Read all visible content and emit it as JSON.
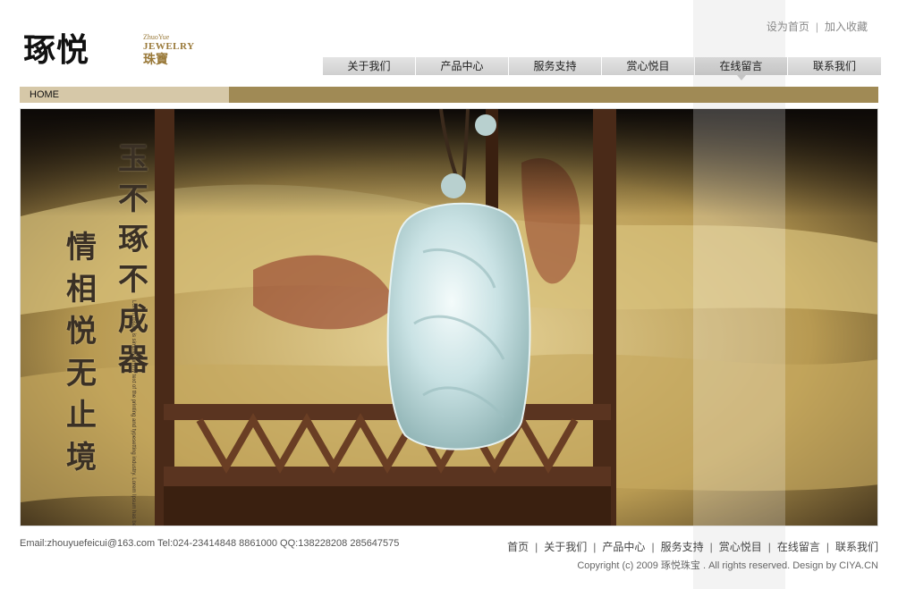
{
  "logo": {
    "main": "琢悦",
    "en_small": "ZhuoYue",
    "en": "JEWELRY",
    "cn": "珠寶"
  },
  "top_links": [
    "设为首页",
    "加入收藏"
  ],
  "nav": {
    "items": [
      "关于我们",
      "产品中心",
      "服务支持",
      "赏心悦目",
      "在线留言",
      "联系我们"
    ],
    "active": "在线留言"
  },
  "breadcrumb": {
    "home": "HOME"
  },
  "banner": {
    "text_a": "玉不琢不成器",
    "text_b": "情相悦无止境",
    "small_text": "Lorem Ipsum is simply dummy text of the printing and typesetting industry. Lorem Ipsum has been the industry's standard dummy text ever since the 1500s, when an unknown printer took a galley of type and scrambled it to make a type specimen book. It has survived not only five centuries, but also the leap into electronic typesetting, remaining essentially unchanged."
  },
  "footer": {
    "contact": "Email:zhouyuefeicui@163.com  Tel:024-23414848 8861000   QQ:138228208 285647575",
    "nav": [
      "首页",
      "关于我们",
      "产品中心",
      "服务支持",
      "赏心悦目",
      "在线留言",
      "联系我们"
    ],
    "copyright": "Copyright (c) 2009 琢悦珠宝 . All rights reserved. Design by CIYA.CN"
  },
  "colors": {
    "crumb_bar": "#a08a55",
    "crumb_home": "#d6c8a8",
    "logo_gold": "#9a7a3a",
    "nav_bg": "#d9d9d9"
  }
}
